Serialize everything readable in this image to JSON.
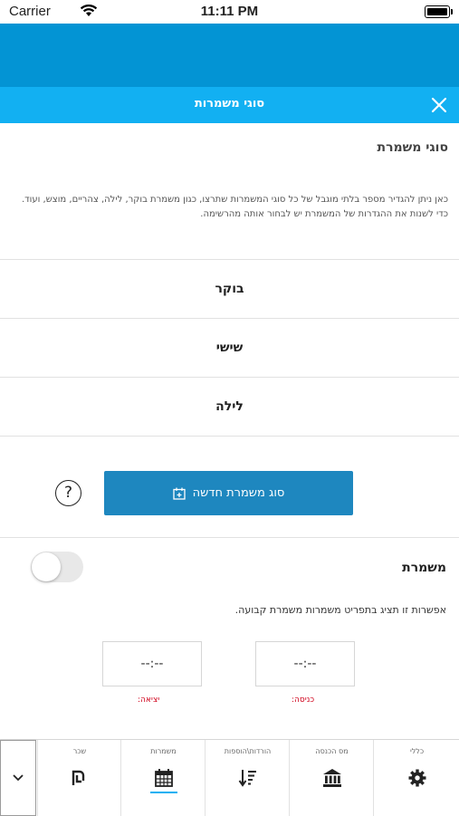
{
  "status_bar": {
    "carrier": "Carrier",
    "time": "11:11 PM"
  },
  "header": {
    "title": "סוגי משמרות"
  },
  "section": {
    "title": "סוגי משמרת",
    "description": "כאן ניתן להגדיר מספר בלתי מוגבל של כל סוגי המשמרות שתרצו, כגון משמרת בוקר, לילה, צהריים, מוצש, ועוד.",
    "description2": "כדי לשנות את ההגדרות של המשמרת יש לבחור אותה מהרשימה."
  },
  "shift_types": [
    {
      "label": "בוקר"
    },
    {
      "label": "שישי"
    },
    {
      "label": "לילה"
    }
  ],
  "new_shift_button": {
    "label": "סוג משמרת חדשה"
  },
  "help": {
    "label": "?"
  },
  "shift_option": {
    "label": "משמרת",
    "enabled": false,
    "description": "אפשרות זו תציג בתפריט משמרות משמרת קבועה."
  },
  "time_fields": {
    "entry": {
      "value": "--:--",
      "label": "כניסה:"
    },
    "exit": {
      "value": "--:--",
      "label": "יציאה:"
    }
  },
  "tabbar": {
    "tabs": [
      {
        "label": "כללי",
        "icon": "gear-icon"
      },
      {
        "label": "מס הכנסה",
        "icon": "bank-icon"
      },
      {
        "label": "הורדות\\הוספות",
        "icon": "sort-icon"
      },
      {
        "label": "משמרות",
        "icon": "calendar-icon",
        "active": true
      },
      {
        "label": "שכר",
        "icon": "shekel-icon"
      }
    ],
    "collapse_icon": "chevron-down-icon"
  },
  "colors": {
    "header_dark": "#0394d4",
    "header_light": "#12b0f2",
    "button": "#1e87bf",
    "label_red": "#d0021b"
  }
}
